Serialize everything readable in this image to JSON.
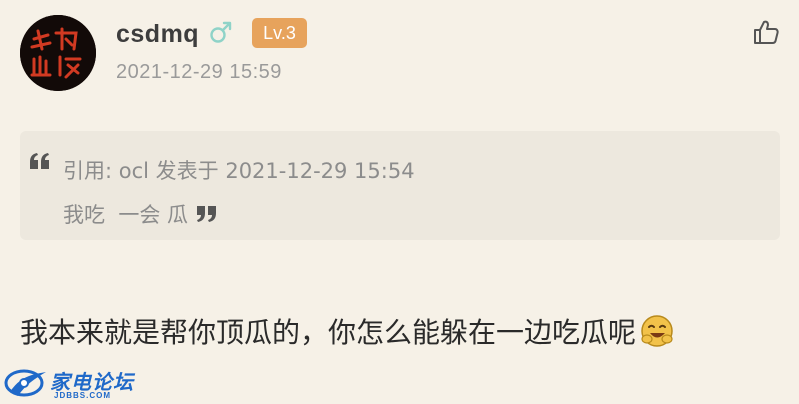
{
  "post": {
    "username": "csdmq",
    "level": "Lv.3",
    "timestamp": "2021-12-29 15:59",
    "reply": "我本来就是帮你顶瓜的，你怎么能躲在一边吃瓜呢"
  },
  "quote": {
    "meta": "引用: ocl 发表于 2021-12-29 15:54",
    "text": "我吃  一会 瓜"
  },
  "watermark": {
    "title": "家电论坛",
    "subtitle": "JDBBS.COM"
  },
  "icons": {
    "avatar": "avatar-image",
    "gender": "male-icon",
    "like": "thumbs-up-icon",
    "quote_open": "open-quote-icon",
    "quote_close": "close-quote-icon",
    "emoji": "grin-emoji-icon",
    "watermark_logo": "swoosh-logo-icon"
  },
  "colors": {
    "background": "#f6f1e7",
    "quote_background": "#ede8de",
    "level_badge": "#e7a35c",
    "gender_icon": "#8fd3c8",
    "watermark_blue": "#1f69c9"
  }
}
